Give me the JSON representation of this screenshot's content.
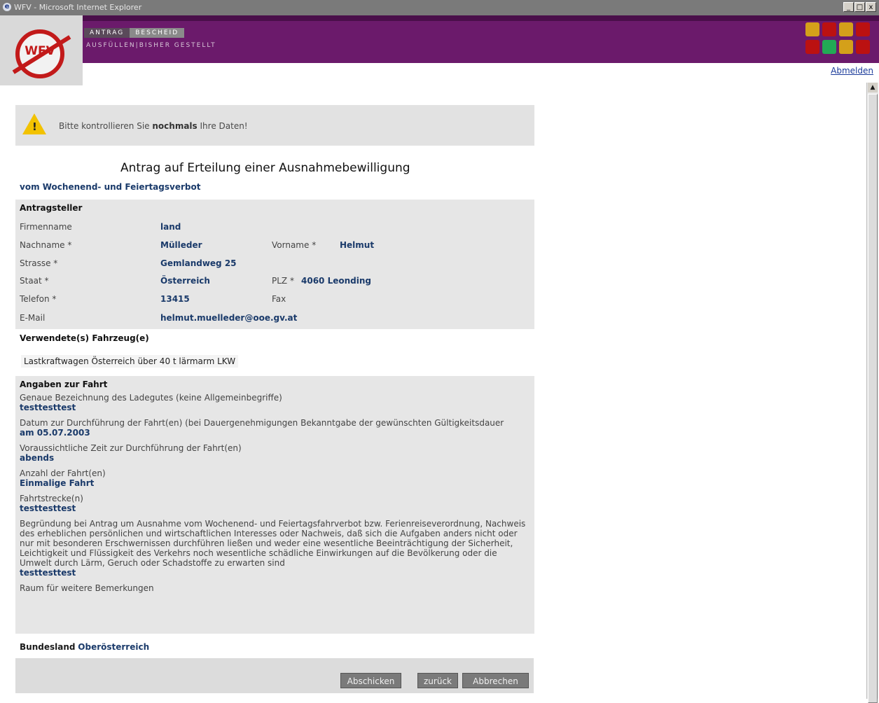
{
  "window": {
    "title": "WFV - Microsoft Internet Explorer",
    "min": "_",
    "max": "□",
    "close": "x"
  },
  "header": {
    "logo_text": "WFV",
    "tabs": [
      "ANTRAG",
      "BESCHEID"
    ],
    "subtabs": "AUSFÜLLEN|BISHER GESTELLT",
    "logout": "Abmelden"
  },
  "alert": {
    "text_prefix": "Bitte kontrollieren Sie ",
    "text_bold": "nochmals",
    "text_suffix": " Ihre Daten!",
    "icon": "warning-icon"
  },
  "form": {
    "title": "Antrag auf Erteilung einer Ausnahmebewilligung",
    "subtitle": "vom Wochenend- und Feiertagsverbot",
    "applicant": {
      "section_title": "Antragsteller",
      "firmenname_label": "Firmenname",
      "firmenname": "land",
      "nachname_label": "Nachname *",
      "nachname": "Mülleder",
      "vorname_label": "Vorname *",
      "vorname": "Helmut",
      "strasse_label": "Strasse *",
      "strasse": "Gemlandweg 25",
      "staat_label": "Staat *",
      "staat": "Österreich",
      "plz_label": "PLZ *",
      "plz": "4060 Leonding",
      "telefon_label": "Telefon *",
      "telefon": "13415",
      "fax_label": "Fax",
      "email_label": "E-Mail",
      "email": "helmut.muelleder@ooe.gv.at"
    },
    "vehicles": {
      "section_title": "Verwendete(s) Fahrzeug(e)",
      "entry": "Lastkraftwagen Österreich über 40 t lärmarm LKW"
    },
    "trip": {
      "section_title": "Angaben zur Fahrt",
      "items": [
        {
          "label": "Genaue Bezeichnung des Ladegutes (keine Allgemeinbegriffe)",
          "value": "testtesttest"
        },
        {
          "label": "Datum zur Durchführung der Fahrt(en) (bei Dauergenehmigungen Bekanntgabe der gewünschten Gültigkeitsdauer",
          "value": "am 05.07.2003"
        },
        {
          "label": "Voraussichtliche Zeit zur Durchführung der Fahrt(en)",
          "value": "abends"
        },
        {
          "label": "Anzahl der Fahrt(en)",
          "value": "Einmalige Fahrt"
        },
        {
          "label": "Fahrtstrecke(n)",
          "value": "testtesttest"
        },
        {
          "label": "Begründung bei Antrag um Ausnahme vom Wochenend- und Feiertagsfahrverbot bzw. Ferienreiseverordnung, Nachweis des erheblichen persönlichen und wirtschaftlichen Interesses oder Nachweis, daß sich die Aufgaben anders nicht oder nur mit besonderen Erschwernissen durchführen ließen und weder eine wesentliche Beeinträchtigung der Sicherheit, Leichtigkeit und Flüssigkeit des Verkehrs noch wesentliche schädliche Einwirkungen auf die Bevölkerung oder die Umwelt durch Lärm, Geruch oder Schadstoffe zu erwarten sind",
          "value": "testtesttest"
        },
        {
          "label": "Raum für weitere Bemerkungen",
          "value": ""
        }
      ],
      "bundesland_label": "Bundesland",
      "bundesland": "Oberösterreich"
    }
  },
  "buttons": {
    "submit": "Abschicken",
    "back": "zurück",
    "cancel": "Abbrechen"
  },
  "colors": {
    "banner": "#6b1a6b",
    "value_text": "#1a3a6a",
    "warning": "#f2c200"
  }
}
